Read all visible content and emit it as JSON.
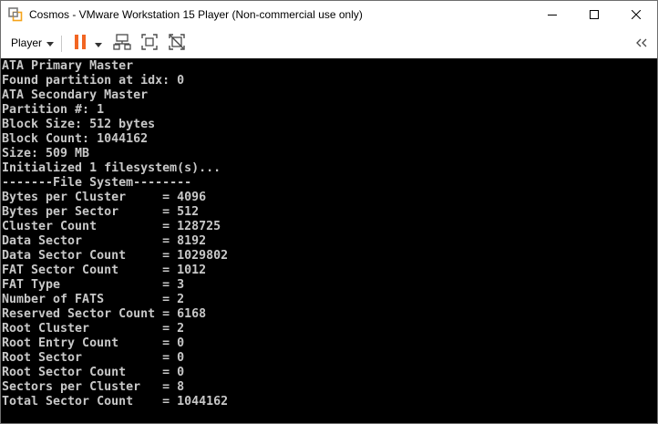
{
  "window": {
    "title": "Cosmos - VMware Workstation 15 Player (Non-commercial use only)"
  },
  "toolbar": {
    "player_label": "Player",
    "accent_color": "#f26522"
  },
  "console": {
    "lines": [
      "ATA Primary Master",
      "Found partition at idx: 0",
      "ATA Secondary Master",
      "Partition #: 1",
      "Block Size: 512 bytes",
      "Block Count: 1044162",
      "Size: 509 MB",
      "Initialized 1 filesystem(s)...",
      "-------File System--------",
      "Bytes per Cluster     = 4096",
      "Bytes per Sector      = 512",
      "Cluster Count         = 128725",
      "Data Sector           = 8192",
      "Data Sector Count     = 1029802",
      "FAT Sector Count      = 1012",
      "FAT Type              = 3",
      "Number of FATS        = 2",
      "Reserved Sector Count = 6168",
      "Root Cluster          = 2",
      "Root Entry Count      = 0",
      "Root Sector           = 0",
      "Root Sector Count     = 0",
      "Sectors per Cluster   = 8",
      "Total Sector Count    = 1044162"
    ]
  }
}
